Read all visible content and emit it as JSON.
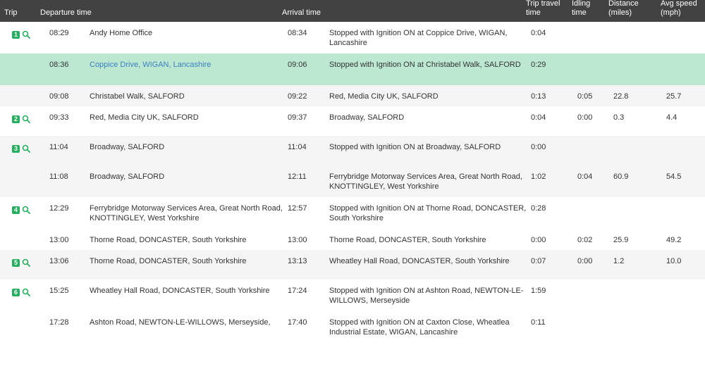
{
  "headers": {
    "trip": "Trip",
    "departure": "Departure time",
    "arrival": "Arrival time",
    "travel": [
      "Trip travel",
      "time"
    ],
    "idling": [
      "Idling",
      "time"
    ],
    "distance": [
      "Distance",
      "(miles)"
    ],
    "speed": [
      "Avg speed",
      "(mph)"
    ]
  },
  "rows": [
    {
      "trip": "1",
      "dep_time": "08:29",
      "dep_loc": [
        "Andy Home Office"
      ],
      "arr_time": "08:34",
      "arr_loc": [
        "Stopped with Ignition ON at Coppice Drive, WIGAN,",
        "Lancashire"
      ],
      "travel": "0:04",
      "idle": "",
      "dist": "",
      "speed": ""
    },
    {
      "trip": "",
      "dep_time": "08:36",
      "dep_loc": [
        "Coppice Drive, WIGAN, Lancashire"
      ],
      "arr_time": "09:06",
      "arr_loc": [
        "Stopped with Ignition ON at Christabel Walk, SALFORD"
      ],
      "travel": "0:29",
      "idle": "",
      "dist": "",
      "speed": ""
    },
    {
      "trip": "",
      "dep_time": "09:08",
      "dep_loc": [
        "Christabel Walk, SALFORD"
      ],
      "arr_time": "09:22",
      "arr_loc": [
        "Red, Media City UK, SALFORD"
      ],
      "travel": "0:13",
      "idle": "0:05",
      "dist": "22.8",
      "speed": "25.7"
    },
    {
      "trip": "2",
      "dep_time": "09:33",
      "dep_loc": [
        "Red, Media City UK, SALFORD"
      ],
      "arr_time": "09:37",
      "arr_loc": [
        "Broadway, SALFORD"
      ],
      "travel": "0:04",
      "idle": "0:00",
      "dist": "0.3",
      "speed": "4.4"
    },
    {
      "trip": "3",
      "dep_time": "11:04",
      "dep_loc": [
        "Broadway, SALFORD"
      ],
      "arr_time": "11:04",
      "arr_loc": [
        "Stopped with Ignition ON at Broadway, SALFORD"
      ],
      "travel": "0:00",
      "idle": "",
      "dist": "",
      "speed": ""
    },
    {
      "trip": "",
      "dep_time": "11:08",
      "dep_loc": [
        "Broadway, SALFORD"
      ],
      "arr_time": "12:11",
      "arr_loc": [
        "Ferrybridge Motorway Services Area, Great North Road,",
        "KNOTTINGLEY, West Yorkshire"
      ],
      "travel": "1:02",
      "idle": "0:04",
      "dist": "60.9",
      "speed": "54.5"
    },
    {
      "trip": "4",
      "dep_time": "12:29",
      "dep_loc": [
        "Ferrybridge Motorway Services Area, Great North Road,",
        "KNOTTINGLEY, West Yorkshire"
      ],
      "arr_time": "12:57",
      "arr_loc": [
        "Stopped with Ignition ON at Thorne Road, DONCASTER,",
        "South Yorkshire"
      ],
      "travel": "0:28",
      "idle": "",
      "dist": "",
      "speed": ""
    },
    {
      "trip": "",
      "dep_time": "13:00",
      "dep_loc": [
        "Thorne Road, DONCASTER, South Yorkshire"
      ],
      "arr_time": "13:00",
      "arr_loc": [
        "Thorne Road, DONCASTER, South Yorkshire"
      ],
      "travel": "0:00",
      "idle": "0:02",
      "dist": "25.9",
      "speed": "49.2"
    },
    {
      "trip": "5",
      "dep_time": "13:06",
      "dep_loc": [
        "Thorne Road, DONCASTER, South Yorkshire"
      ],
      "arr_time": "13:13",
      "arr_loc": [
        "Wheatley Hall Road, DONCASTER, South Yorkshire"
      ],
      "travel": "0:07",
      "idle": "0:00",
      "dist": "1.2",
      "speed": "10.0"
    },
    {
      "trip": "6",
      "dep_time": "15:25",
      "dep_loc": [
        "Wheatley Hall Road, DONCASTER, South Yorkshire"
      ],
      "arr_time": "17:24",
      "arr_loc": [
        "Stopped with Ignition ON at Ashton Road, NEWTON-LE-",
        "WILLOWS, Merseyside"
      ],
      "travel": "1:59",
      "idle": "",
      "dist": "",
      "speed": ""
    },
    {
      "trip": "",
      "dep_time": "17:28",
      "dep_loc": [
        "Ashton Road, NEWTON-LE-WILLOWS, Merseyside,"
      ],
      "arr_time": "17:40",
      "arr_loc": [
        "Stopped with Ignition ON at Caxton Close, Wheatlea",
        "Industrial Estate, WIGAN, Lancashire"
      ],
      "travel": "0:11",
      "idle": "",
      "dist": "",
      "speed": ""
    }
  ],
  "colors": {
    "header_bg": "#424242",
    "highlight": "#bce8d2",
    "badge": "#27ae60",
    "link": "#3a7fc1"
  },
  "icons": {
    "trip_badge": "number-badge",
    "zoom": "magnifier-icon"
  }
}
